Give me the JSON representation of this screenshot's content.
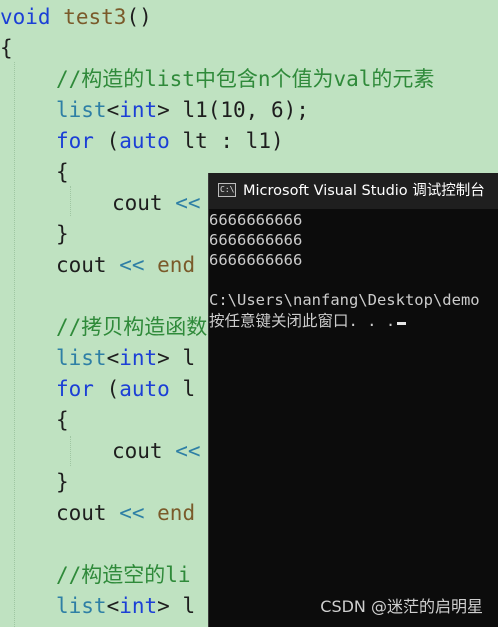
{
  "editor": {
    "lines": [
      {
        "kind": "func_decl",
        "keyword": "void",
        "name": "test3",
        "rest": "()"
      },
      {
        "kind": "brace",
        "text": "{"
      },
      {
        "kind": "comment",
        "text": "//构造的list中包含n个值为val的元素"
      },
      {
        "kind": "decl",
        "type": "list",
        "lt": "<",
        "tparam": "int",
        "rest": "> l1(10, 6);"
      },
      {
        "kind": "for",
        "kw": "for",
        "mid": " (",
        "auto": "auto",
        "rest": " lt : l1)"
      },
      {
        "kind": "brace",
        "text": "{"
      },
      {
        "kind": "cout",
        "name": "cout",
        "op": " <<"
      },
      {
        "kind": "brace",
        "text": "}"
      },
      {
        "kind": "coutend",
        "name": "cout",
        "op": " <<",
        "end": " end"
      },
      {
        "kind": "blank",
        "text": ""
      },
      {
        "kind": "comment",
        "text": "//拷贝构造函数"
      },
      {
        "kind": "decl",
        "type": "list",
        "lt": "<",
        "tparam": "int",
        "rest": "> l"
      },
      {
        "kind": "for",
        "kw": "for",
        "mid": " (",
        "auto": "auto",
        "rest": " l"
      },
      {
        "kind": "brace",
        "text": "{"
      },
      {
        "kind": "cout",
        "name": "cout",
        "op": " <<"
      },
      {
        "kind": "brace",
        "text": "}"
      },
      {
        "kind": "coutend",
        "name": "cout",
        "op": " <<",
        "end": " end"
      },
      {
        "kind": "blank",
        "text": ""
      },
      {
        "kind": "comment",
        "text": "//构造空的li"
      },
      {
        "kind": "decl",
        "type": "list",
        "lt": "<",
        "tparam": "int",
        "rest": "> l"
      }
    ]
  },
  "console": {
    "title": "Microsoft Visual Studio 调试控制台",
    "icon_name": "console-app-icon",
    "icon_text": "C:\\",
    "output": [
      "6666666666",
      "6666666666",
      "6666666666",
      "",
      "C:\\Users\\nanfang\\Desktop\\demo",
      "按任意键关闭此窗口. . ."
    ]
  },
  "watermark": "CSDN @迷茫的启明星",
  "colors": {
    "editor_bg": "#bfe2c1",
    "keyword": "#1b3fd6",
    "comment": "#2f8a3a",
    "type": "#2e7fa5",
    "function": "#7a5a2a",
    "console_bg": "#0c0c0c",
    "console_text": "#cccccc"
  }
}
